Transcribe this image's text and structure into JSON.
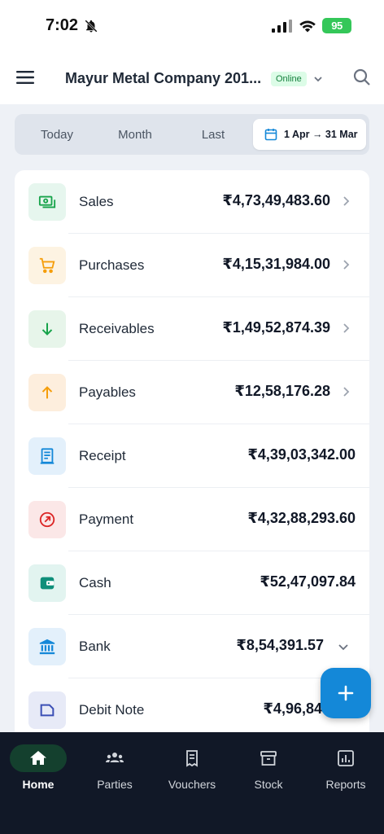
{
  "status_bar": {
    "time": "7:02",
    "battery": "95"
  },
  "header": {
    "company": "Mayur Metal Company 201...",
    "badge": "Online"
  },
  "period_tabs": {
    "today": "Today",
    "month": "Month",
    "last": "Last",
    "range": "1 Apr → 31 Mar"
  },
  "rows": [
    {
      "label": "Sales",
      "amount": "₹4,73,49,483.60",
      "icon": "banknote-icon",
      "color": "#16a34a",
      "bg": "#e6f6ee"
    },
    {
      "label": "Purchases",
      "amount": "₹4,15,31,984.00",
      "icon": "cart-icon",
      "color": "#f59e0b",
      "bg": "#fdf3e2"
    },
    {
      "label": "Receivables",
      "amount": "₹1,49,52,874.39",
      "icon": "arrow-down-icon",
      "color": "#16a34a",
      "bg": "#e7f5ea"
    },
    {
      "label": "Payables",
      "amount": "₹12,58,176.28",
      "icon": "arrow-up-icon",
      "color": "#f59e0b",
      "bg": "#fdeedd"
    },
    {
      "label": "Receipt",
      "amount": "₹4,39,03,342.00",
      "icon": "receipt-icon",
      "color": "#1488d8",
      "bg": "#e3f0fb"
    },
    {
      "label": "Payment",
      "amount": "₹4,32,88,293.60",
      "icon": "payment-icon",
      "color": "#dc2626",
      "bg": "#fbe7e7"
    },
    {
      "label": "Cash",
      "amount": "₹52,47,097.84",
      "icon": "wallet-icon",
      "color": "#0f8f7a",
      "bg": "#e2f4f0"
    },
    {
      "label": "Bank",
      "amount": "₹8,54,391.57",
      "icon": "bank-icon",
      "color": "#1488d8",
      "bg": "#e3f0fb"
    },
    {
      "label": "Debit Note",
      "amount": "₹4,96,84",
      "icon": "debit-note-icon",
      "color": "#3b4fb5",
      "bg": "#e7eaf7"
    }
  ],
  "nav": {
    "home": "Home",
    "parties": "Parties",
    "vouchers": "Vouchers",
    "stock": "Stock",
    "reports": "Reports"
  }
}
